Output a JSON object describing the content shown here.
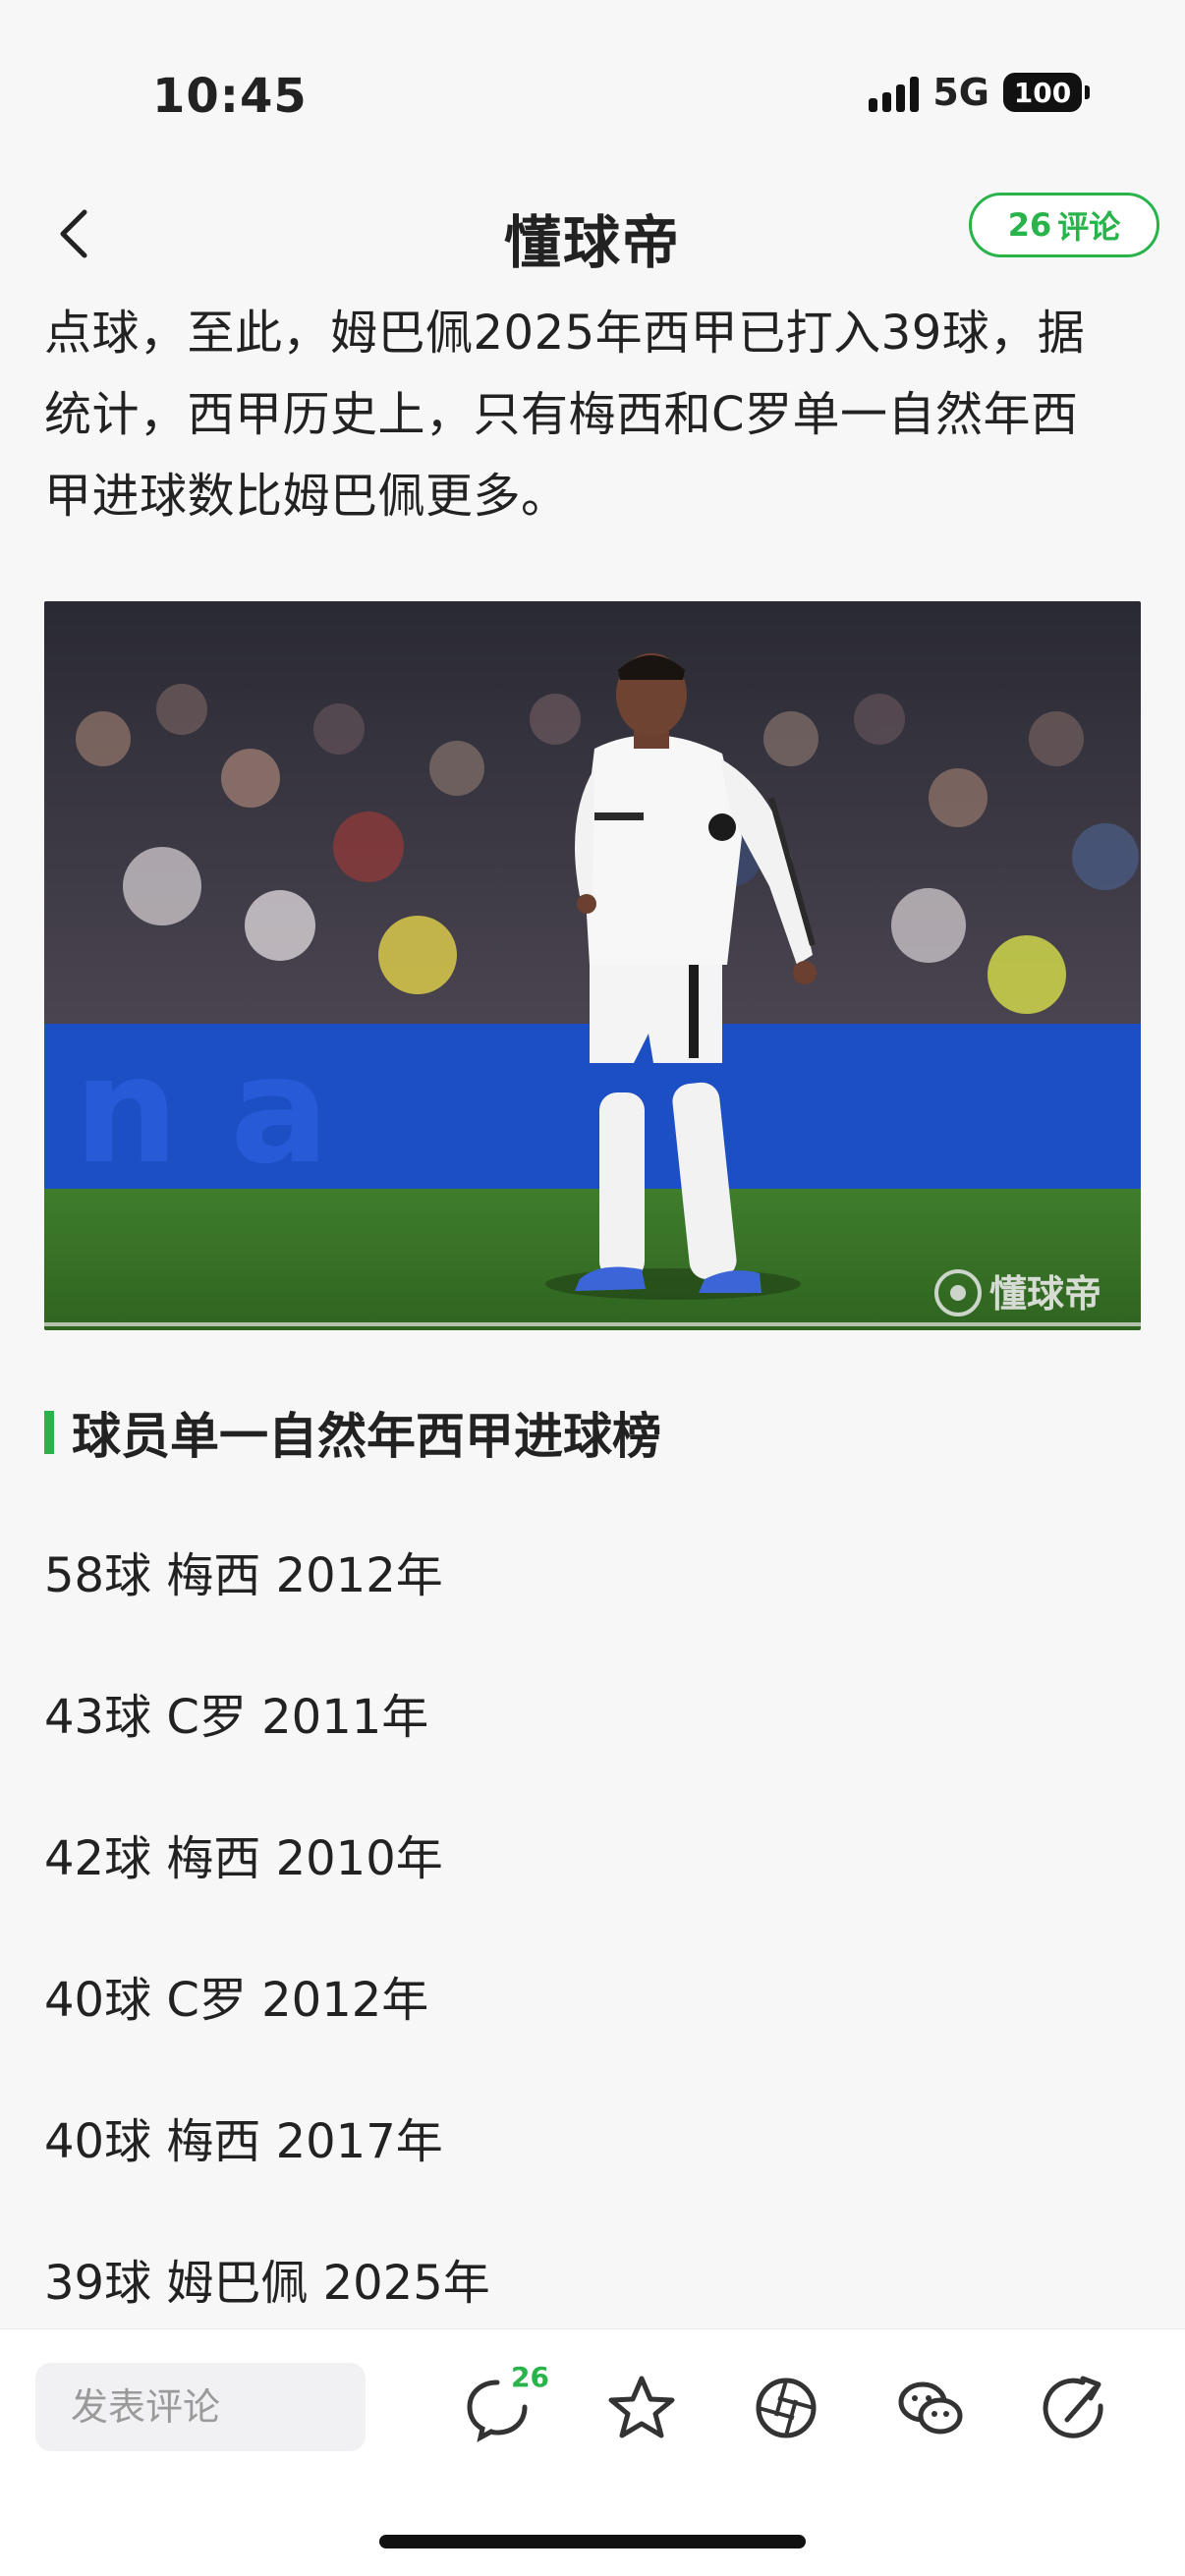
{
  "status": {
    "time": "10:45",
    "network": "5G",
    "battery": "100"
  },
  "nav": {
    "title": "懂球帝",
    "comment_count": "26",
    "comment_suffix": "评论"
  },
  "article": {
    "paragraph_lines": [
      "点球，至此，姆巴佩2025年西甲已打入39球，据",
      "统计，西甲历史上，只有梅西和C罗单一自然年西",
      "甲进球数比姆巴佩更多。"
    ],
    "photo_watermark": "懂球帝",
    "section_title": "球员单一自然年西甲进球榜",
    "rankings": [
      "58球 梅西 2012年",
      "43球 C罗 2011年",
      "42球 梅西 2010年",
      "40球 C罗 2012年",
      "40球 梅西 2017年",
      "39球 姆巴佩 2025年"
    ]
  },
  "bottom": {
    "input_placeholder": "发表评论",
    "comment_badge": "26"
  },
  "colors": {
    "accent": "#29b34b"
  }
}
